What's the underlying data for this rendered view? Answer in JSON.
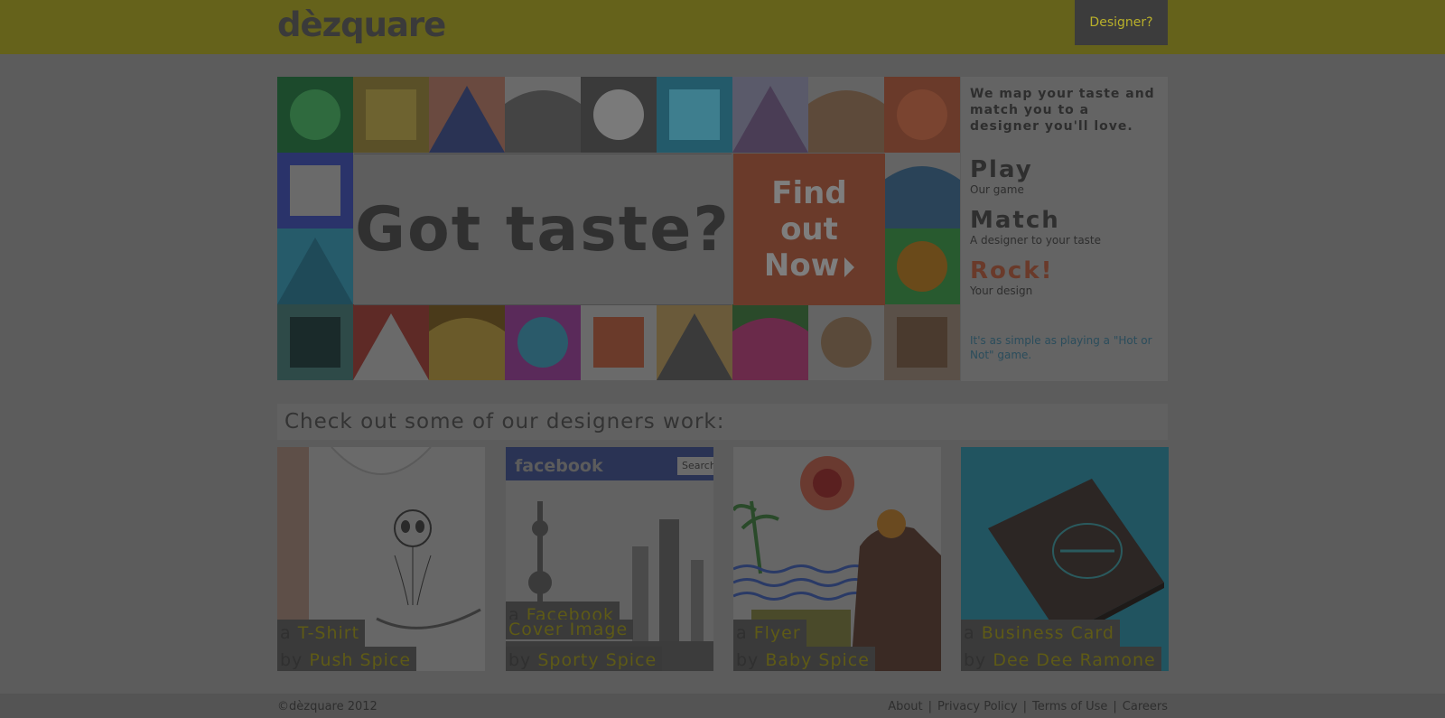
{
  "header": {
    "logo": "dèzquare",
    "designer_button": "Designer?"
  },
  "hero": {
    "headline": "Got taste?",
    "cta": {
      "line1": "Find",
      "line2": "out",
      "line3": "Now"
    },
    "tiles": [
      {
        "name": "lets-start-typography-tile",
        "bg": "#1c4a2c",
        "fg": "#2f6a3e"
      },
      {
        "name": "wood-texture-tile",
        "bg": "#5a5028",
        "fg": "#6e6330"
      },
      {
        "name": "do-letters-tile",
        "bg": "#6a4a40",
        "fg": "#2a3354"
      },
      {
        "name": "geometric-letters-tile",
        "bg": "#6a6a6a",
        "fg": "#444"
      },
      {
        "name": "black-white-sketch-tile",
        "bg": "#3a3a3a",
        "fg": "#7a7a7a"
      },
      {
        "name": "abc-letters-tile",
        "bg": "#235a6a",
        "fg": "#3e7e8e"
      },
      {
        "name": "purple-face-tile",
        "bg": "#5a5a6a",
        "fg": "#4a3d55"
      },
      {
        "name": "old-man-illustration-tile",
        "bg": "#646464",
        "fg": "#5d4a3a"
      },
      {
        "name": "red-pattern-tile",
        "bg": "#6a3a2a",
        "fg": "#7a4430"
      },
      {
        "name": "vw-bus-tile",
        "bg": "#2a336a",
        "fg": "#6a6a6a"
      },
      {
        "name": "blue-swirl-tile",
        "bg": "#265b6a",
        "fg": "#1f4a58"
      },
      {
        "name": "blue-figure-tile",
        "bg": "#646464",
        "fg": "#2a4358"
      },
      {
        "name": "orange-fruit-tile",
        "bg": "#285a2f",
        "fg": "#6a4a1a"
      },
      {
        "name": "couple-silhouette-tile",
        "bg": "#2e4a48",
        "fg": "#1a2a2a"
      },
      {
        "name": "red-shoe-tile",
        "bg": "#5e2a26",
        "fg": "#6a6a6a"
      },
      {
        "name": "golden-light-tile",
        "bg": "#4a3a1a",
        "fg": "#6a5a2a"
      },
      {
        "name": "pink-monster-tile",
        "bg": "#5a2a5a",
        "fg": "#2a5a6a"
      },
      {
        "name": "target-circles-tile",
        "bg": "#6a6a6a",
        "fg": "#6a3a2a"
      },
      {
        "name": "cartoon-dog-tile",
        "bg": "#6a5a3a",
        "fg": "#3a3a3a"
      },
      {
        "name": "tropical-leaves-tile",
        "bg": "#2a4a2a",
        "fg": "#6a2a4a"
      },
      {
        "name": "wooden-seal-tile",
        "bg": "#646464",
        "fg": "#5a4a3a"
      },
      {
        "name": "armadillo-tile",
        "bg": "#5a5048",
        "fg": "#4a3a2e"
      }
    ]
  },
  "side_panel": {
    "intro": "We map your taste and match you to a designer you'll love.",
    "steps": [
      {
        "title": "Play",
        "desc": "Our game"
      },
      {
        "title": "Match",
        "desc": "A designer to your taste"
      },
      {
        "title": "Rock!",
        "desc": "Your design"
      }
    ],
    "note": "It's as simple as playing a \"Hot or Not\" game."
  },
  "section": {
    "title": "Check out some of our designers work:"
  },
  "cards": [
    {
      "prefix": "a",
      "item": "T-Shirt",
      "by": "by",
      "designer": "Push Spice"
    },
    {
      "prefix": "a",
      "item": "Facebook",
      "item2": "Cover Image",
      "by": "by",
      "designer": "Sporty Spice",
      "fb_logo": "facebook",
      "fb_search": "Search"
    },
    {
      "prefix": "a",
      "item": "Flyer",
      "by": "by",
      "designer": "Baby Spice"
    },
    {
      "prefix": "a",
      "item": "Business Card",
      "by": "by",
      "designer": "Dee Dee Ramone"
    }
  ],
  "footer": {
    "copyright": "©dèzquare 2012",
    "links": [
      "About",
      "Privacy Policy",
      "Terms of Use",
      "Careers"
    ],
    "separator": "|"
  },
  "colors": {
    "overlay_dim": "#5c5c5c",
    "header_bg": "#65621b",
    "accent_yellow": "#b9b02a",
    "cta_orange": "#6a3a2a",
    "link_blue": "#2b4d5c"
  }
}
